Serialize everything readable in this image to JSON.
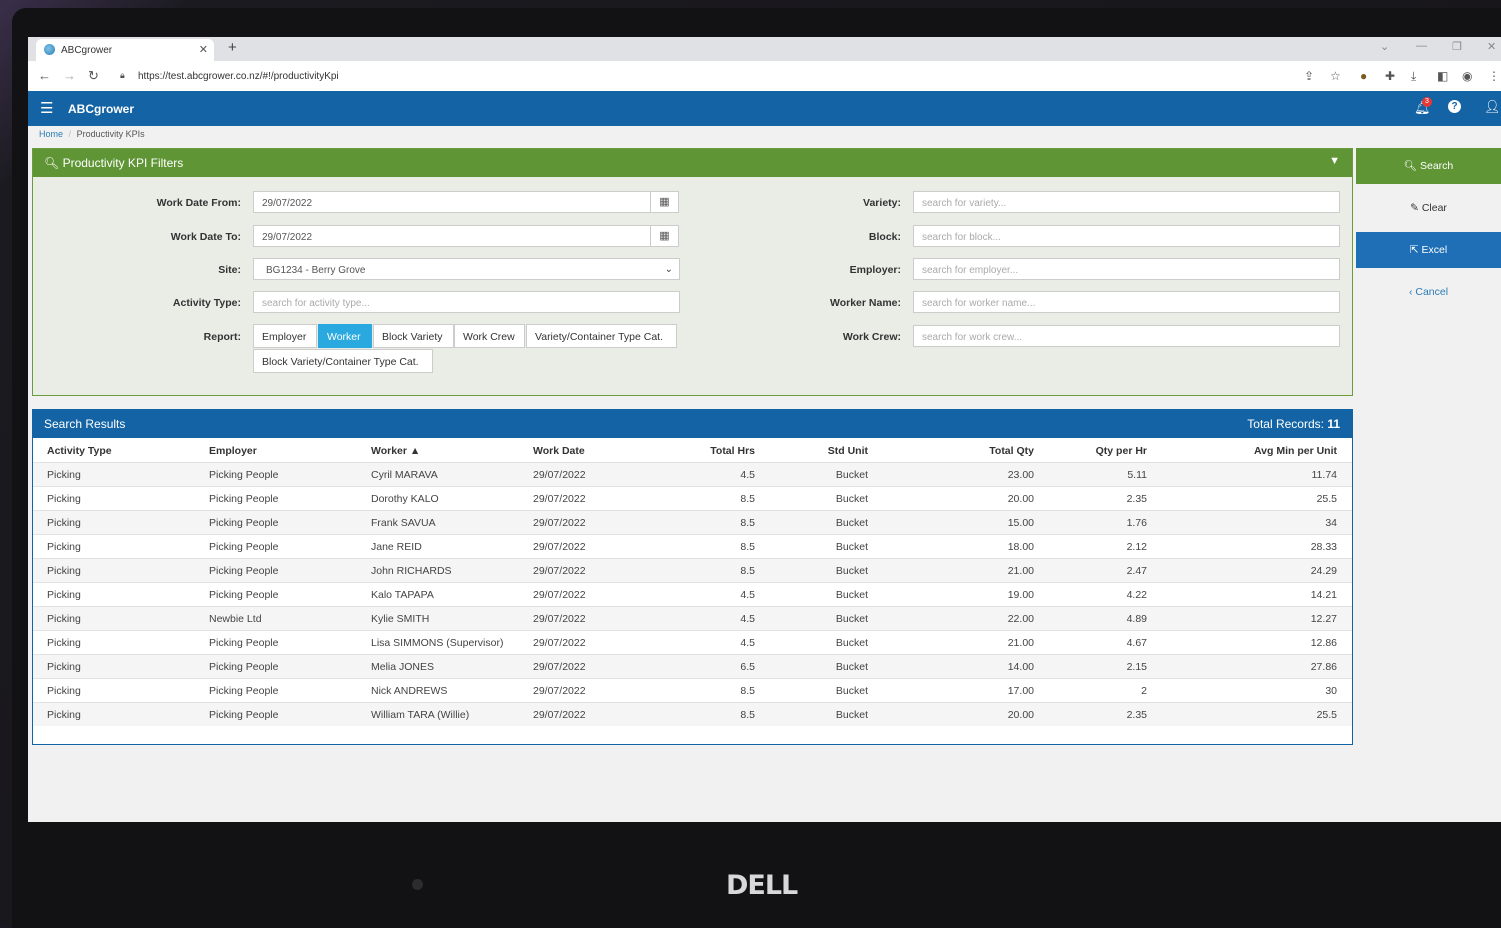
{
  "browser": {
    "tab_title": "ABCgrower",
    "new_tab": "+",
    "url": "https://test.abcgrower.co.nz/#!/productivityKpi"
  },
  "app": {
    "brand": "ABCgrower",
    "notification_count": "3",
    "help": "?"
  },
  "breadcrumb": {
    "home": "Home",
    "separator": "/",
    "current": "Productivity KPIs"
  },
  "filters": {
    "title": "Productivity KPI Filters",
    "work_date_from": {
      "label": "Work Date From:",
      "value": "29/07/2022"
    },
    "work_date_to": {
      "label": "Work Date To:",
      "value": "29/07/2022"
    },
    "site": {
      "label": "Site:",
      "value": "BG1234 - Berry Grove"
    },
    "activity_type": {
      "label": "Activity Type:",
      "placeholder": "search for activity type..."
    },
    "report": {
      "label": "Report:",
      "options": [
        "Employer",
        "Worker",
        "Block Variety",
        "Work Crew",
        "Variety/Container Type Cat.",
        "Block Variety/Container Type Cat."
      ],
      "selected": "Worker"
    },
    "variety": {
      "label": "Variety:",
      "placeholder": "search for variety..."
    },
    "block": {
      "label": "Block:",
      "placeholder": "search for block..."
    },
    "employer": {
      "label": "Employer:",
      "placeholder": "search for employer..."
    },
    "worker_name": {
      "label": "Worker Name:",
      "placeholder": "search for worker name..."
    },
    "work_crew": {
      "label": "Work Crew:",
      "placeholder": "search for work crew..."
    }
  },
  "actions": {
    "search": "Search",
    "clear": "Clear",
    "excel": "Excel",
    "cancel": "Cancel"
  },
  "results": {
    "title": "Search Results",
    "total_label": "Total Records:",
    "total_count": "11",
    "columns": [
      "Activity Type",
      "Employer",
      "Worker",
      "Work Date",
      "Total Hrs",
      "Std Unit",
      "Total Qty",
      "Qty per Hr",
      "Avg Min per Unit"
    ],
    "rows": [
      [
        "Picking",
        "Picking People",
        "Cyril MARAVA",
        "29/07/2022",
        "4.5",
        "Bucket",
        "23.00",
        "5.11",
        "11.74"
      ],
      [
        "Picking",
        "Picking People",
        "Dorothy KALO",
        "29/07/2022",
        "8.5",
        "Bucket",
        "20.00",
        "2.35",
        "25.5"
      ],
      [
        "Picking",
        "Picking People",
        "Frank SAVUA",
        "29/07/2022",
        "8.5",
        "Bucket",
        "15.00",
        "1.76",
        "34"
      ],
      [
        "Picking",
        "Picking People",
        "Jane REID",
        "29/07/2022",
        "8.5",
        "Bucket",
        "18.00",
        "2.12",
        "28.33"
      ],
      [
        "Picking",
        "Picking People",
        "John RICHARDS",
        "29/07/2022",
        "8.5",
        "Bucket",
        "21.00",
        "2.47",
        "24.29"
      ],
      [
        "Picking",
        "Picking People",
        "Kalo TAPAPA",
        "29/07/2022",
        "4.5",
        "Bucket",
        "19.00",
        "4.22",
        "14.21"
      ],
      [
        "Picking",
        "Newbie Ltd",
        "Kylie SMITH",
        "29/07/2022",
        "4.5",
        "Bucket",
        "22.00",
        "4.89",
        "12.27"
      ],
      [
        "Picking",
        "Picking People",
        "Lisa SIMMONS (Supervisor)",
        "29/07/2022",
        "4.5",
        "Bucket",
        "21.00",
        "4.67",
        "12.86"
      ],
      [
        "Picking",
        "Picking People",
        "Melia JONES",
        "29/07/2022",
        "6.5",
        "Bucket",
        "14.00",
        "2.15",
        "27.86"
      ],
      [
        "Picking",
        "Picking People",
        "Nick ANDREWS",
        "29/07/2022",
        "8.5",
        "Bucket",
        "17.00",
        "2",
        "30"
      ],
      [
        "Picking",
        "Picking People",
        "William TARA (Willie)",
        "29/07/2022",
        "8.5",
        "Bucket",
        "20.00",
        "2.35",
        "25.5"
      ]
    ]
  },
  "device": {
    "brand": "DELL"
  }
}
